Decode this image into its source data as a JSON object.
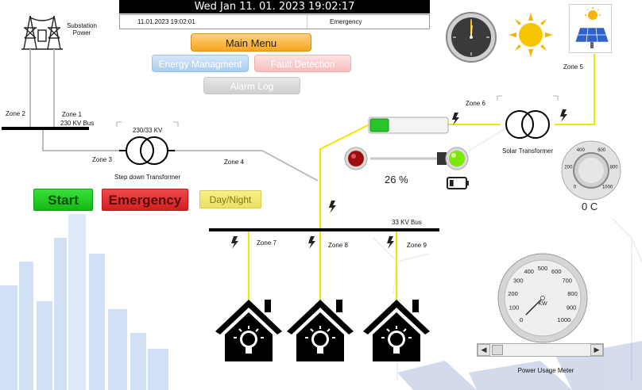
{
  "header": {
    "datetime": "Wed Jan 11. 01. 2023 19:02:17",
    "status_timestamp": "11.01.2023 19:02:01",
    "status_message": "Emergency"
  },
  "menu": {
    "main_menu": "Main Menu",
    "energy_management": "Energy Managment",
    "fault_detection": "Fault Detection",
    "alarm_log": "Alarm Log"
  },
  "controls": {
    "start": "Start",
    "emergency": "Emergency",
    "day_night": "Day/Night"
  },
  "diagram": {
    "substation_power": [
      "Substation",
      "Power"
    ],
    "zone1": "Zone 1",
    "zone2": "Zone 2",
    "zone3": "Zone 3",
    "zone4": "Zone 4",
    "zone5": "Zone 5",
    "zone6": "Zone 6",
    "zone7": "Zone 7",
    "zone8": "Zone 8",
    "zone9": "Zone 9",
    "bus_230": "230 KV Bus",
    "bus_33": "33 KV Bus",
    "transformer_rating": "230/33 KV",
    "step_down_transformer": "Step down Transformer",
    "solar_transformer": "Solar  Transformer"
  },
  "indicators": {
    "battery_percent_text": "26 %",
    "battery_percent": 26,
    "temperature": "0 C"
  },
  "temperature_dial": {
    "scale": [
      "0",
      "200",
      "400",
      "600",
      "800",
      "1000"
    ]
  },
  "power_meter": {
    "title": "Power Usage Meter",
    "unit": "KW",
    "scale": [
      "0",
      "100",
      "200",
      "300",
      "400",
      "500",
      "600",
      "700",
      "800",
      "900",
      "1000"
    ],
    "value": 0
  },
  "colors": {
    "live_line": "#f2e600",
    "dead_line": "#b8b8b8",
    "bus": "#000000",
    "start": "#1cc71c",
    "emergency": "#e02a2a",
    "day_night": "#f2ea70",
    "main_menu": "#f7b13a"
  },
  "icons": [
    "transmission-tower-icon",
    "transformer-icon",
    "clock-icon",
    "sun-icon",
    "solar-panel-icon",
    "lightning-icon",
    "house-bulb-icon",
    "battery-icon",
    "red-lamp-icon",
    "green-lamp-icon"
  ]
}
